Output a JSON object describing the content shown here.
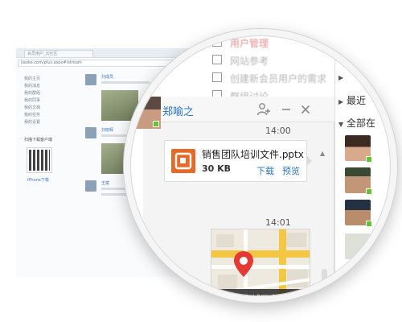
{
  "background_page": {
    "tab_title": "会员用户_云社区",
    "url": "jiaoke.com/plus.aspx#/stream",
    "sidebar_items": [
      "我的主页",
      "我的消息",
      "我的群组",
      "我的同事",
      "我的文档",
      "我的任务",
      "我的设置"
    ],
    "qr_caption": "扫描下载客户端",
    "qr_link": "iPhone下载",
    "post_names": [
      "刘成员",
      "刘晓辉",
      "王斌"
    ]
  },
  "checklist": {
    "items": [
      {
        "label": "用户管理",
        "highlighted": true
      },
      {
        "label": "网站参考",
        "highlighted": false
      },
      {
        "label": "创建新会员用户的需求",
        "highlighted": false
      },
      {
        "label": "群组讨论",
        "highlighted": false
      }
    ]
  },
  "chat": {
    "contact_name": "郑喻之",
    "header_icons": [
      "add-user-icon",
      "minimize-icon",
      "close-icon"
    ],
    "messages": [
      {
        "time": "14:00",
        "type": "file",
        "file_name": "销售团队培训文件.pptx",
        "file_size": "30 KB",
        "actions": {
          "download": "下载",
          "preview": "预览"
        }
      },
      {
        "time": "14:01",
        "type": "location",
        "address": "北京市东城区幸福大街"
      }
    ],
    "accent_color": "#2a74c4",
    "file_icon_color": "#e86a2b",
    "pin_color": "#e53935"
  },
  "contacts_panel": {
    "groups": [
      {
        "label": "",
        "expanded": false
      },
      {
        "label": "最近",
        "expanded": false
      },
      {
        "label": "全部在",
        "expanded": true
      }
    ],
    "presence_color": "#62c42f"
  }
}
